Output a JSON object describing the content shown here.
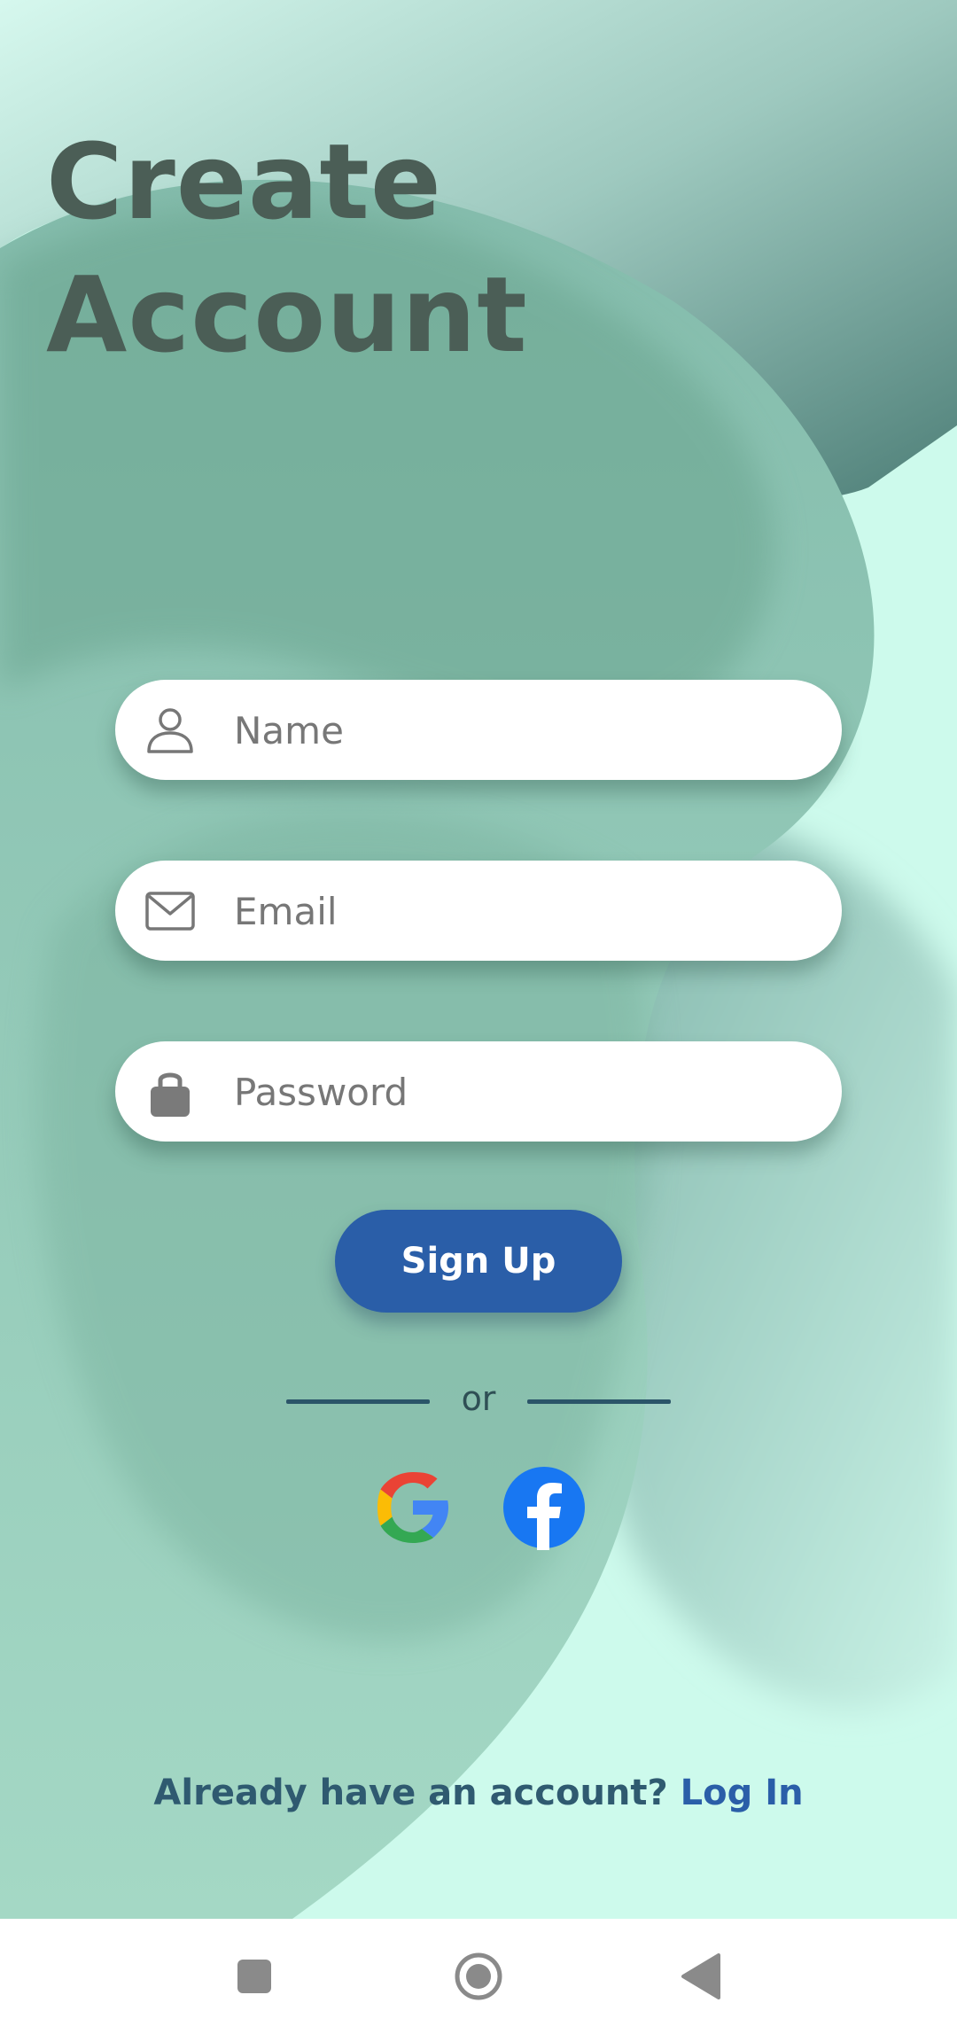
{
  "page": {
    "title_line1": "Create",
    "title_line2": "Account"
  },
  "form": {
    "name_placeholder": "Name",
    "email_placeholder": "Email",
    "password_placeholder": "Password",
    "signup_label": "Sign Up",
    "divider_text": "or"
  },
  "social": {
    "google_icon": "google-icon",
    "facebook_icon": "facebook-icon"
  },
  "footer": {
    "prompt": "Already have an account? ",
    "login_link": "Log In"
  },
  "colors": {
    "accent": "#2a5ea8",
    "title": "#4b5e56",
    "background": "#cdfaec"
  },
  "navbar": {
    "icons": [
      "square-recent-apps-icon",
      "circle-home-icon",
      "triangle-back-icon"
    ]
  }
}
